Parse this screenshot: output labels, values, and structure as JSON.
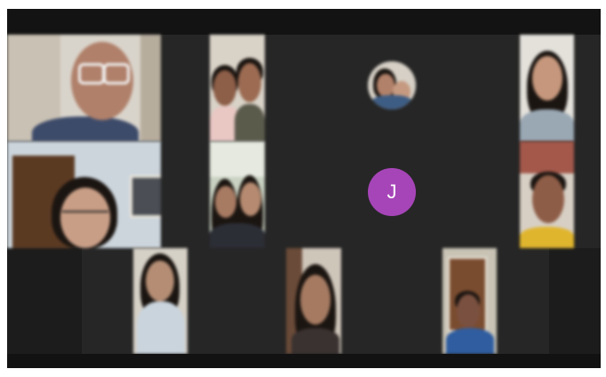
{
  "meeting": {
    "participants": [
      {
        "tile": "video",
        "desc": "man-with-white-glasses"
      },
      {
        "tile": "video",
        "desc": "two-people-selfie"
      },
      {
        "tile": "avatar-photo",
        "desc": "profile-picture"
      },
      {
        "tile": "video",
        "desc": "woman-smiling"
      },
      {
        "tile": "video",
        "desc": "woman-with-glasses"
      },
      {
        "tile": "video",
        "desc": "two-girls"
      },
      {
        "tile": "avatar-letter",
        "initial": "J"
      },
      {
        "tile": "video",
        "desc": "man-yellow-shirt"
      },
      {
        "tile": "video",
        "desc": "woman-in-room"
      },
      {
        "tile": "video",
        "desc": "girl-close-up"
      },
      {
        "tile": "video",
        "desc": "person-at-door"
      }
    ]
  },
  "colors": {
    "background": "#1c1c1c",
    "avatar_letter_bg": "#a645b8"
  }
}
